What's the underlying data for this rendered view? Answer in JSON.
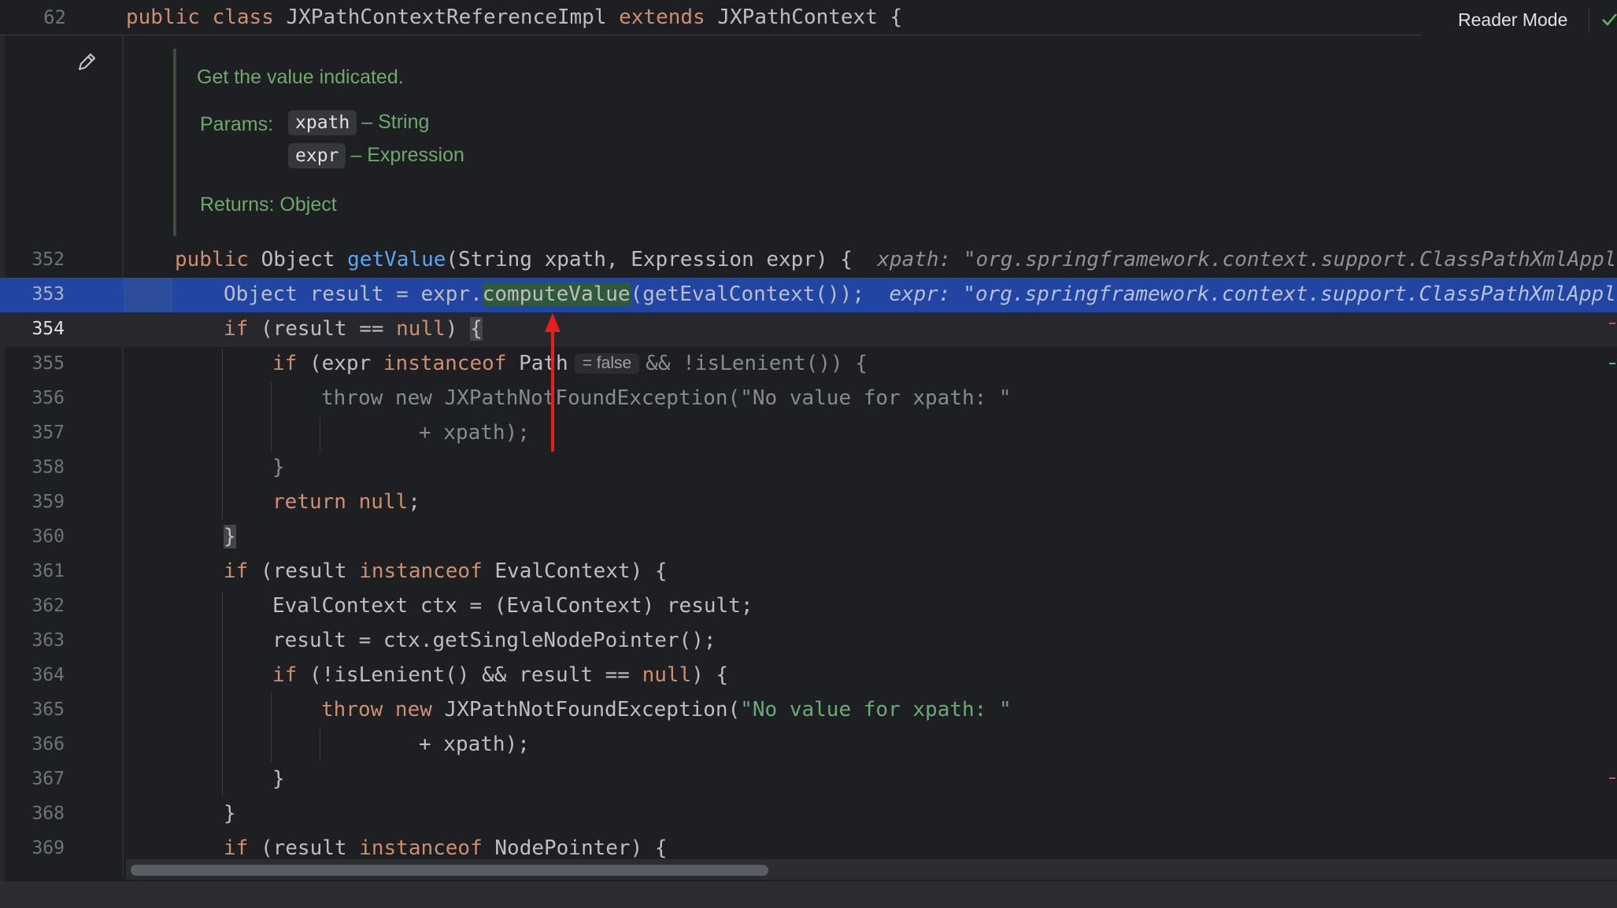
{
  "sticky": {
    "line_number": "62",
    "kw_public": "public ",
    "kw_class": "class ",
    "class_name": "JXPathContextReferenceImpl ",
    "kw_extends": "extends ",
    "parent": "JXPathContext {"
  },
  "toolbar": {
    "reader_mode_label": "Reader Mode"
  },
  "doc": {
    "description": "Get the value indicated.",
    "params_label": "Params:",
    "param1_name": "xpath",
    "param1_desc": "– String",
    "param2_name": "expr",
    "param2_desc": "– Expression",
    "returns": "Returns: Object"
  },
  "lines": {
    "l352": {
      "num": "352",
      "a": "public ",
      "b": "Object ",
      "c": "getValue",
      "d": "(String xpath, Expression expr) {",
      "hint": "xpath: \"org.springframework.context.support.ClassPathXmlAppl"
    },
    "l353": {
      "num": "353",
      "a": "Object result = expr.",
      "b": "computeValue",
      "c": "(getEvalContext());",
      "hint": "expr: \"org.springframework.context.support.ClassPathXmlAppl"
    },
    "l354": {
      "num": "354",
      "a": "if ",
      "b": "(result == ",
      "c": "null",
      "d": ") ",
      "e": "{"
    },
    "l355": {
      "num": "355",
      "a": "if ",
      "b": "(expr ",
      "c": "instanceof ",
      "d": "Path",
      "inlay": "= false",
      "e": "&& !isLenient()) {"
    },
    "l356": {
      "num": "356",
      "a": "throw new JXPathNotFoundException(\"No value for xpath: \""
    },
    "l357": {
      "num": "357",
      "a": "+ xpath);"
    },
    "l358": {
      "num": "358",
      "a": "}"
    },
    "l359": {
      "num": "359",
      "a": "return ",
      "b": "null",
      "c": ";"
    },
    "l360": {
      "num": "360",
      "a": "}"
    },
    "l361": {
      "num": "361",
      "a": "if ",
      "b": "(result ",
      "c": "instanceof ",
      "d": "EvalContext) {"
    },
    "l362": {
      "num": "362",
      "a": "EvalContext ctx = (EvalContext) result;"
    },
    "l363": {
      "num": "363",
      "a": "result = ctx.getSingleNodePointer();"
    },
    "l364": {
      "num": "364",
      "a": "if ",
      "b": "(!isLenient() && result == ",
      "c": "null",
      "d": ") {"
    },
    "l365": {
      "num": "365",
      "a": "throw new ",
      "b": "JXPathNotFoundException(",
      "c": "\"No value for xpath: \""
    },
    "l366": {
      "num": "366",
      "a": "+ xpath);"
    },
    "l367": {
      "num": "367",
      "a": "}"
    },
    "l368": {
      "num": "368",
      "a": "}"
    },
    "l369": {
      "num": "369",
      "a": "if ",
      "b": "(result ",
      "c": "instanceof ",
      "d": "NodePointer) {"
    }
  },
  "colors": {
    "keyword": "#cf8e6d",
    "method": "#56a8f5",
    "string": "#6aab73",
    "doc_text": "#6ea86b",
    "selection": "#2145a3",
    "annotation_arrow": "#e8201c"
  }
}
